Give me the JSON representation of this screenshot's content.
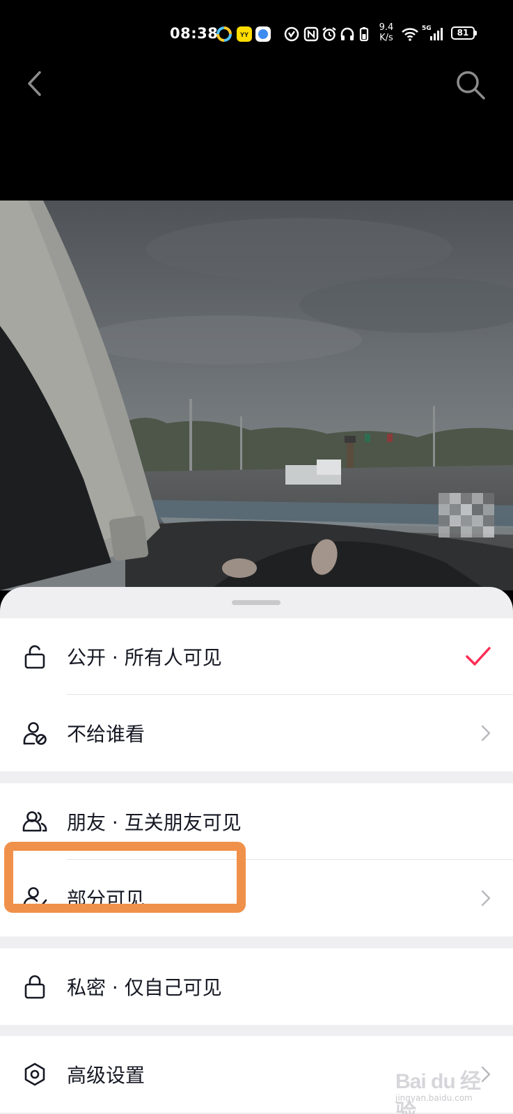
{
  "status_bar": {
    "time": "08:38",
    "net_speed_value": "9.4",
    "net_speed_unit": "K/s",
    "signal_label": "5G",
    "battery": "81"
  },
  "nav": {
    "back_icon": "chevron-left-icon",
    "search_icon": "search-icon"
  },
  "sheet": {
    "groups": [
      {
        "items": [
          {
            "label": "公开 · 所有人可见",
            "icon": "unlock-icon",
            "selected": true
          },
          {
            "label": "不给谁看",
            "icon": "user-block-icon",
            "chevron": true
          }
        ]
      },
      {
        "items": [
          {
            "label": "朋友 · 互关朋友可见",
            "icon": "friends-icon"
          },
          {
            "label": "部分可见",
            "icon": "user-check-icon",
            "chevron": true
          }
        ]
      },
      {
        "items": [
          {
            "label": "私密 · 仅自己可见",
            "icon": "lock-icon"
          }
        ]
      },
      {
        "items": [
          {
            "label": "高级设置",
            "icon": "settings-hexagon-icon",
            "chevron": true
          }
        ]
      }
    ],
    "check_color": "#fe2c55"
  },
  "annotation": {
    "highlight_color": "#f0914b"
  },
  "watermark": {
    "main": "Bai du 经验",
    "sub": "jingyan.baidu.com"
  }
}
